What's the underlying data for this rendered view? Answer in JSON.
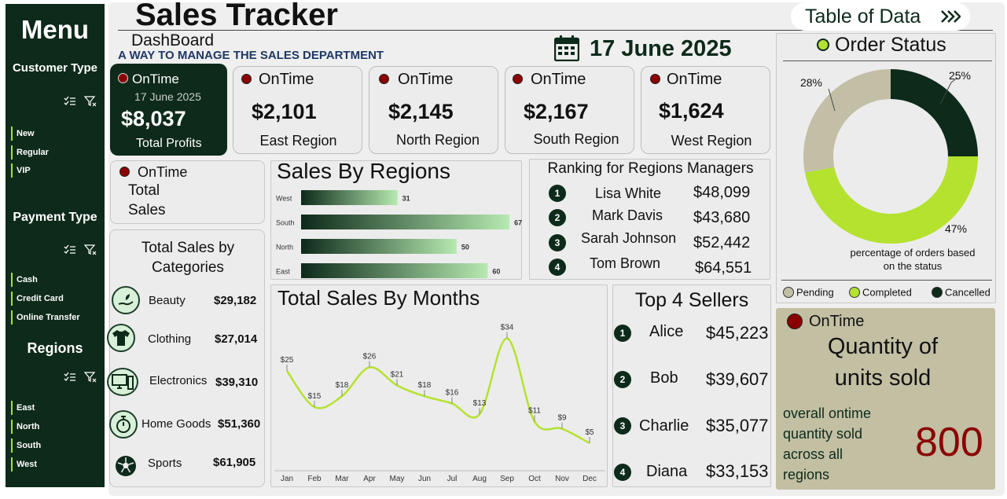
{
  "sidebar": {
    "title": "Menu",
    "customer_type": {
      "label": "Customer Type",
      "items": [
        "New",
        "Regular",
        "VIP"
      ]
    },
    "payment_type": {
      "label": "Payment Type",
      "items": [
        "Cash",
        "Credit Card",
        "Online Transfer"
      ]
    },
    "regions": {
      "label": "Regions",
      "items": [
        "East",
        "North",
        "South",
        "West"
      ]
    }
  },
  "header": {
    "title": "Sales Tracker",
    "subtitle": "DashBoard",
    "tagline": "A WAY TO MANAGE THE SALES DEPARTMENT",
    "date": "17 June 2025",
    "table_button": "Table of Data",
    "table_button_icon": "double-chevron-right-icon"
  },
  "profits_card": {
    "badge": "OnTime",
    "date": "17 June 2025",
    "value": "$8,037",
    "label": "Total Profits"
  },
  "region_cards": [
    {
      "badge": "OnTime",
      "value": "$2,101",
      "name": "East Region"
    },
    {
      "badge": "OnTime",
      "value": "$2,145",
      "name": "North Region"
    },
    {
      "badge": "OnTime",
      "value": "$2,167",
      "name": "South Region"
    },
    {
      "badge": "OnTime",
      "value": "$1,624",
      "name": "West Region"
    }
  ],
  "total_sales_card": {
    "badge": "OnTime",
    "line1": "Total",
    "line2": "Sales"
  },
  "categories": {
    "title_line1": "Total Sales by",
    "title_line2": "Categories",
    "items": [
      {
        "name": "Beauty",
        "value": "$29,182",
        "icon": "beauty-hand-icon"
      },
      {
        "name": "Clothing",
        "value": "$27,014",
        "icon": "tshirt-icon"
      },
      {
        "name": "Electronics",
        "value": "$39,310",
        "icon": "computer-icon"
      },
      {
        "name": "Home Goods",
        "value": "$51,360",
        "icon": "stopwatch-icon"
      },
      {
        "name": "Sports",
        "value": "$61,905",
        "icon": "soccer-ball-icon"
      }
    ]
  },
  "regions_chart": {
    "title": "Sales By Regions"
  },
  "months_chart": {
    "title": "Total Sales By Months"
  },
  "managers": {
    "title": "Ranking for Regions Managers",
    "items": [
      {
        "rank": "1",
        "name": "Lisa White",
        "value": "$48,099"
      },
      {
        "rank": "2",
        "name": "Mark Davis",
        "value": "$43,680"
      },
      {
        "rank": "3",
        "name": "Sarah Johnson",
        "value": "$52,442"
      },
      {
        "rank": "4",
        "name": "Tom Brown",
        "value": "$64,551"
      }
    ]
  },
  "sellers": {
    "title": "Top 4 Sellers",
    "items": [
      {
        "rank": "1",
        "name": "Alice",
        "value": "$45,223"
      },
      {
        "rank": "2",
        "name": "Bob",
        "value": "$39,607"
      },
      {
        "rank": "3",
        "name": "Charlie",
        "value": "$35,077"
      },
      {
        "rank": "4",
        "name": "Diana",
        "value": "$33,153"
      }
    ]
  },
  "order_status": {
    "title": "Order Status",
    "caption_line1": "percentage of orders based",
    "caption_line2": "on the status"
  },
  "quantity_card": {
    "badge": "OnTime",
    "title_line1": "Quantity of",
    "title_line2": "units sold",
    "desc": [
      "overall ontime",
      "quantity sold",
      "across all",
      "regions"
    ],
    "value": "800"
  },
  "colors": {
    "dark_green": "#0d2a1a",
    "lime": "#b5e22f",
    "beige": "#c3bfa7",
    "ontime_red": "#8b0000",
    "quantity_bg": "#c2bfa3"
  },
  "chart_data": [
    {
      "type": "bar",
      "title": "Sales By Regions",
      "orientation": "horizontal",
      "categories": [
        "West",
        "South",
        "North",
        "East"
      ],
      "values": [
        31,
        67,
        50,
        60
      ],
      "xlim": [
        0,
        70
      ],
      "grid": false
    },
    {
      "type": "line",
      "title": "Total Sales By Months",
      "categories": [
        "Jan",
        "Feb",
        "Mar",
        "Apr",
        "May",
        "Jun",
        "Jul",
        "Aug",
        "Sep",
        "Oct",
        "Nov",
        "Dec"
      ],
      "values": [
        25,
        15,
        18,
        26,
        21,
        18,
        16,
        13,
        34,
        11,
        9,
        5
      ],
      "data_labels": [
        "$25",
        "$15",
        "$18",
        "$26",
        "$21",
        "$18",
        "$16",
        "$13",
        "$34",
        "$11",
        "$9",
        "$5"
      ],
      "ylim": [
        0,
        40
      ],
      "grid": false,
      "color": "#b5e22f"
    },
    {
      "type": "pie",
      "title": "Order Status",
      "donut": true,
      "labels": [
        "Cancelled",
        "Completed",
        "Pending"
      ],
      "values": [
        25,
        47,
        28
      ],
      "data_labels": [
        "25%",
        "47%",
        "28%"
      ],
      "legend": [
        "Pending",
        "Completed",
        "Cancelled"
      ],
      "legend_position": "bottom",
      "colors": [
        "#0d2a1a",
        "#b5e22f",
        "#c3bfa7"
      ]
    }
  ]
}
